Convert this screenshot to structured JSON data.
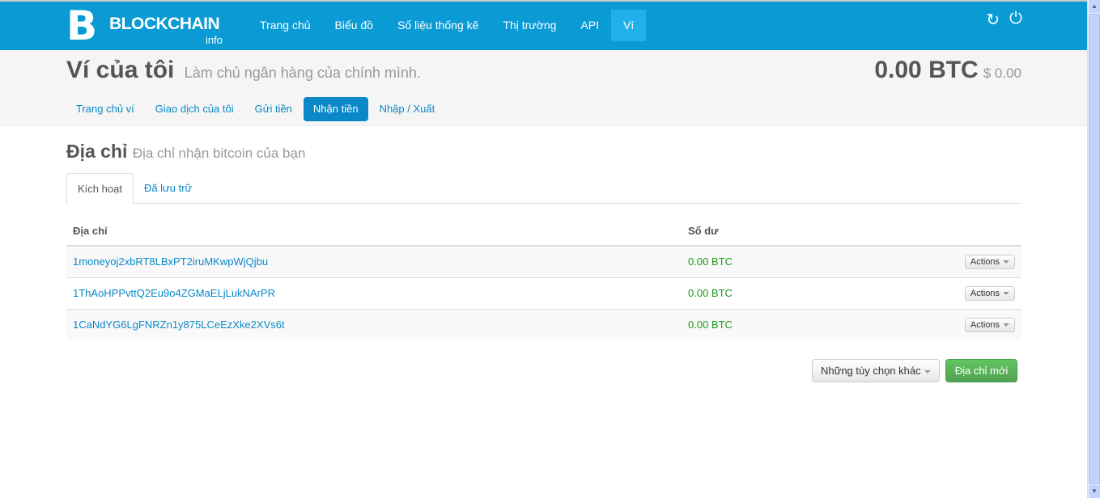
{
  "brand": {
    "logo_letter": "B",
    "name": "BLOCKCHAIN",
    "sub": "info"
  },
  "nav": [
    "Trang chủ",
    "Biểu đồ",
    "Số liệu thống kê",
    "Thị trường",
    "API",
    "Ví"
  ],
  "header": {
    "title": "Ví của tôi",
    "subtitle": "Làm chủ ngân hàng của chính mình.",
    "balance": "0.00 BTC",
    "balance_usd": "$ 0.00"
  },
  "pills": [
    "Trang chủ ví",
    "Giao dịch của tôi",
    "Gửi tiền",
    "Nhận tiền",
    "Nhập / Xuất"
  ],
  "section": {
    "title": "Địa chỉ",
    "subtitle": "Địa chỉ nhận bitcoin của bạn"
  },
  "tabs": [
    "Kích hoạt",
    "Đã lưu trữ"
  ],
  "table": {
    "headers": [
      "Địa chỉ",
      "Số dư"
    ],
    "rows": [
      {
        "address": "1moneyoj2xbRT8LBxPT2iruMKwpWjQjbu",
        "balance": "0.00 BTC",
        "action": "Actions"
      },
      {
        "address": "1ThAoHPPvttQ2Eu9o4ZGMaELjLukNArPR",
        "balance": "0.00 BTC",
        "action": "Actions"
      },
      {
        "address": "1CaNdYG6LgFNRZn1y875LCeEzXke2XVs6t",
        "balance": "0.00 BTC",
        "action": "Actions"
      }
    ]
  },
  "buttons": {
    "more": "Những tùy chọn khác",
    "new_address": "Địa chỉ mới"
  },
  "icons": {
    "refresh": "↻",
    "power": "⏻"
  }
}
